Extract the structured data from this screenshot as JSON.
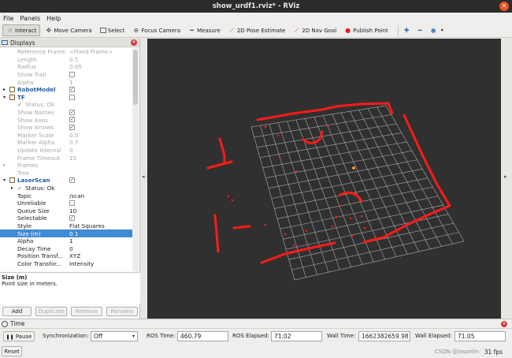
{
  "window": {
    "title": "show_urdf1.rviz* - RViz"
  },
  "menu": [
    "File",
    "Panels",
    "Help"
  ],
  "toolbar": {
    "tools": [
      {
        "label": "Interact",
        "icon": "interact-icon"
      },
      {
        "label": "Move Camera",
        "icon": "move-camera-icon"
      },
      {
        "label": "Select",
        "icon": "select-icon"
      },
      {
        "label": "Focus Camera",
        "icon": "focus-camera-icon"
      },
      {
        "label": "Measure",
        "icon": "measure-icon"
      },
      {
        "label": "2D Pose Estimate",
        "icon": "pose-estimate-icon"
      },
      {
        "label": "2D Nav Goal",
        "icon": "nav-goal-icon"
      },
      {
        "label": "Publish Point",
        "icon": "publish-point-icon"
      }
    ]
  },
  "displays": {
    "title": "Displays",
    "rows": [
      {
        "key": "Reference Frame",
        "value": "<Fixed Frame>",
        "indent": 22,
        "disabled": true
      },
      {
        "key": "Length",
        "value": "0.5",
        "indent": 22,
        "disabled": true
      },
      {
        "key": "Radius",
        "value": "0.05",
        "indent": 22,
        "disabled": true
      },
      {
        "key": "Show Trail",
        "check": "",
        "indent": 22,
        "disabled": true
      },
      {
        "key": "Alpha",
        "value": "1",
        "indent": 22,
        "disabled": true
      },
      {
        "key": "RobotModel",
        "check": "✓",
        "indent": 22,
        "arrow": "▸",
        "bold": true
      },
      {
        "key": "TF",
        "check": "",
        "indent": 22,
        "arrow": "▾",
        "bold": true
      },
      {
        "key": "Status: Ok",
        "indent": 32,
        "disabled": true,
        "status": true
      },
      {
        "key": "Show Names",
        "check": "✓",
        "indent": 22,
        "disabled": true
      },
      {
        "key": "Show Axes",
        "check": "✓",
        "indent": 22,
        "disabled": true
      },
      {
        "key": "Show Arrows",
        "check": "✓",
        "indent": 22,
        "disabled": true
      },
      {
        "key": "Marker Scale",
        "value": "0.5",
        "indent": 22,
        "disabled": true
      },
      {
        "key": "Marker Alpha",
        "value": "0.7",
        "indent": 22,
        "disabled": true
      },
      {
        "key": "Update Interval",
        "value": "0",
        "indent": 22,
        "disabled": true
      },
      {
        "key": "Frame Timeout",
        "value": "15",
        "indent": 22,
        "disabled": true
      },
      {
        "key": "Frames",
        "indent": 22,
        "disabled": true,
        "arrow": "▸"
      },
      {
        "key": "Tree",
        "indent": 22,
        "disabled": true
      },
      {
        "key": "LaserScan",
        "check": "✓",
        "indent": 22,
        "arrow": "▾",
        "bold": true
      },
      {
        "key": "Status: Ok",
        "indent": 32,
        "status": true,
        "arrow": "▸"
      },
      {
        "key": "Topic",
        "value": "/scan",
        "indent": 22
      },
      {
        "key": "Unreliable",
        "check": "",
        "indent": 22
      },
      {
        "key": "Queue Size",
        "value": "10",
        "indent": 22
      },
      {
        "key": "Selectable",
        "check": "✓",
        "indent": 22
      },
      {
        "key": "Style",
        "value": "Flat Squares",
        "indent": 22
      },
      {
        "key": "Size (m)",
        "value": "0.1",
        "indent": 22,
        "selected": true
      },
      {
        "key": "Alpha",
        "value": "1",
        "indent": 22
      },
      {
        "key": "Decay Time",
        "value": "0",
        "indent": 22
      },
      {
        "key": "Position Transf...",
        "value": "XYZ",
        "indent": 22
      },
      {
        "key": "Color Transfor...",
        "value": "Intensity",
        "indent": 22
      }
    ],
    "description": {
      "title": "Size (m)",
      "text": "Point size in meters."
    },
    "buttons": [
      "Add",
      "Duplicate",
      "Remove",
      "Rename"
    ]
  },
  "time": {
    "title": "Time",
    "pause_label": "Pause",
    "sync_label": "Synchronization:",
    "sync_value": "Off",
    "ros_time_label": "ROS Time:",
    "ros_time": "460.79",
    "ros_elapsed_label": "ROS Elapsed:",
    "ros_elapsed": "71.02",
    "wall_time_label": "Wall Time:",
    "wall_time": "1662382659.98",
    "wall_elapsed_label": "Wall Elapsed:",
    "wall_elapsed": "71.05",
    "reset_label": "Reset",
    "fps": "31 fps",
    "watermark": "CSDN @jasonlin"
  },
  "colors": {
    "scan": "#ff1a1a",
    "grid": "#a0a0a0",
    "viewport_bg": "#303030",
    "selection": "#3f8bd6"
  }
}
